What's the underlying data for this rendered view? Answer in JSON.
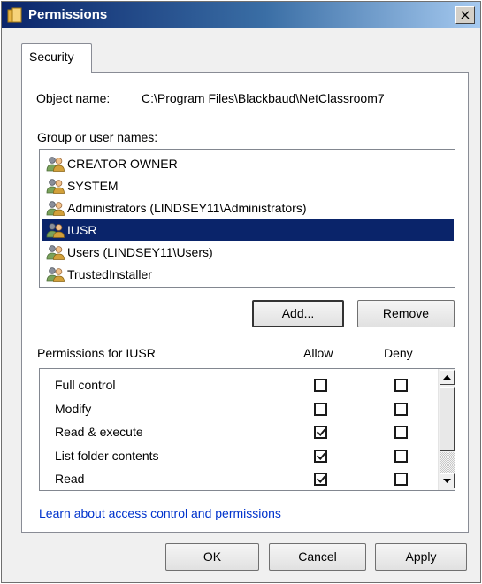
{
  "window": {
    "title": "Permissions",
    "close_label": "×",
    "title_icon": "folder-icon"
  },
  "tabs": [
    {
      "label": "Security",
      "selected": true
    }
  ],
  "object": {
    "label": "Object name:",
    "value": "C:\\Program Files\\Blackbaud\\NetClassroom7"
  },
  "groups": {
    "label": "Group or user names:",
    "items": [
      {
        "label": "CREATOR OWNER",
        "icon": "user-group-icon",
        "selected": false
      },
      {
        "label": "SYSTEM",
        "icon": "user-group-icon",
        "selected": false
      },
      {
        "label": "Administrators (LINDSEY11\\Administrators)",
        "icon": "user-group-icon",
        "selected": false
      },
      {
        "label": "IUSR",
        "icon": "user-group-icon",
        "selected": true
      },
      {
        "label": "Users (LINDSEY11\\Users)",
        "icon": "user-group-icon",
        "selected": false
      },
      {
        "label": "TrustedInstaller",
        "icon": "user-group-icon",
        "selected": false
      }
    ],
    "add_label": "Add...",
    "remove_label": "Remove"
  },
  "permissions": {
    "header": "Permissions for IUSR",
    "allow_label": "Allow",
    "deny_label": "Deny",
    "rows": [
      {
        "name": "Full control",
        "allow": false,
        "deny": false
      },
      {
        "name": "Modify",
        "allow": false,
        "deny": false
      },
      {
        "name": "Read & execute",
        "allow": true,
        "deny": false
      },
      {
        "name": "List folder contents",
        "allow": true,
        "deny": false
      },
      {
        "name": "Read",
        "allow": true,
        "deny": false
      }
    ]
  },
  "link_text": "Learn about access control and permissions",
  "buttons": {
    "ok": "OK",
    "cancel": "Cancel",
    "apply": "Apply"
  },
  "colors": {
    "selection": "#0a246a",
    "link": "#0033cc",
    "title_bar": "#0a246a"
  }
}
